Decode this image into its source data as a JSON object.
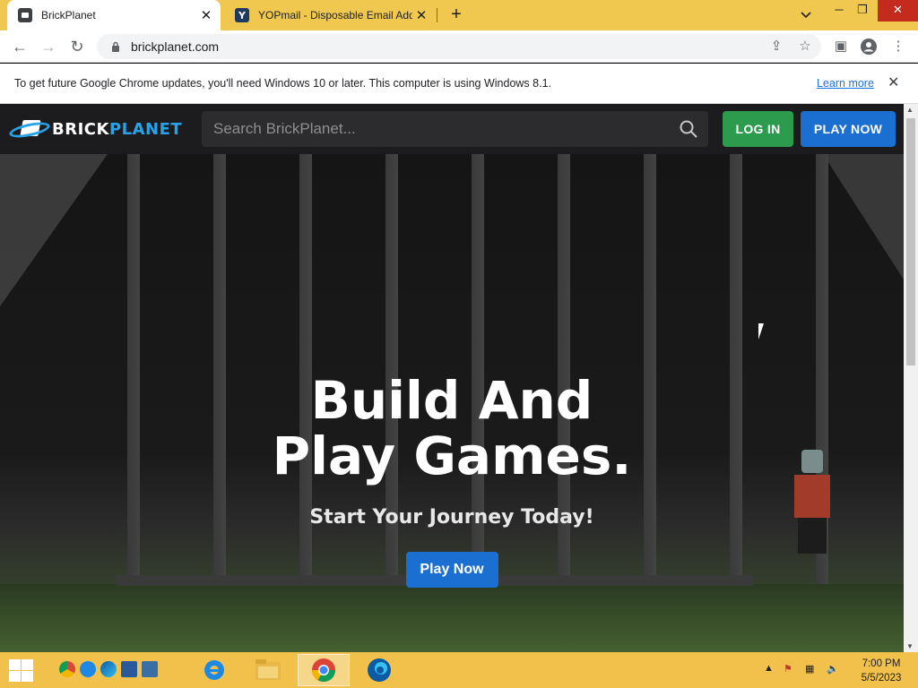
{
  "browser": {
    "tabs": [
      {
        "title": "BrickPlanet"
      },
      {
        "title": "YOPmail - Disposable Email Address"
      }
    ],
    "yop_icon": "Y",
    "url": "brickplanet.com"
  },
  "infobar": {
    "message": "To get future Google Chrome updates, you'll need Windows 10 or later. This computer is using Windows 8.1.",
    "link": "Learn more"
  },
  "site": {
    "logo_part1": "BRICK",
    "logo_part2": "PLANET",
    "search_placeholder": "Search BrickPlanet...",
    "login_label": "LOG IN",
    "play_label": "PLAY NOW"
  },
  "hero": {
    "title": "Build And Play Games.",
    "subtitle": "Start Your Journey Today!",
    "cta": "Play Now"
  },
  "taskbar": {
    "time": "7:00 PM",
    "date": "5/5/2023"
  },
  "colors": {
    "accent_blue": "#1b6fd0",
    "login_green": "#2d9b4e",
    "taskbar": "#f2c14b"
  }
}
